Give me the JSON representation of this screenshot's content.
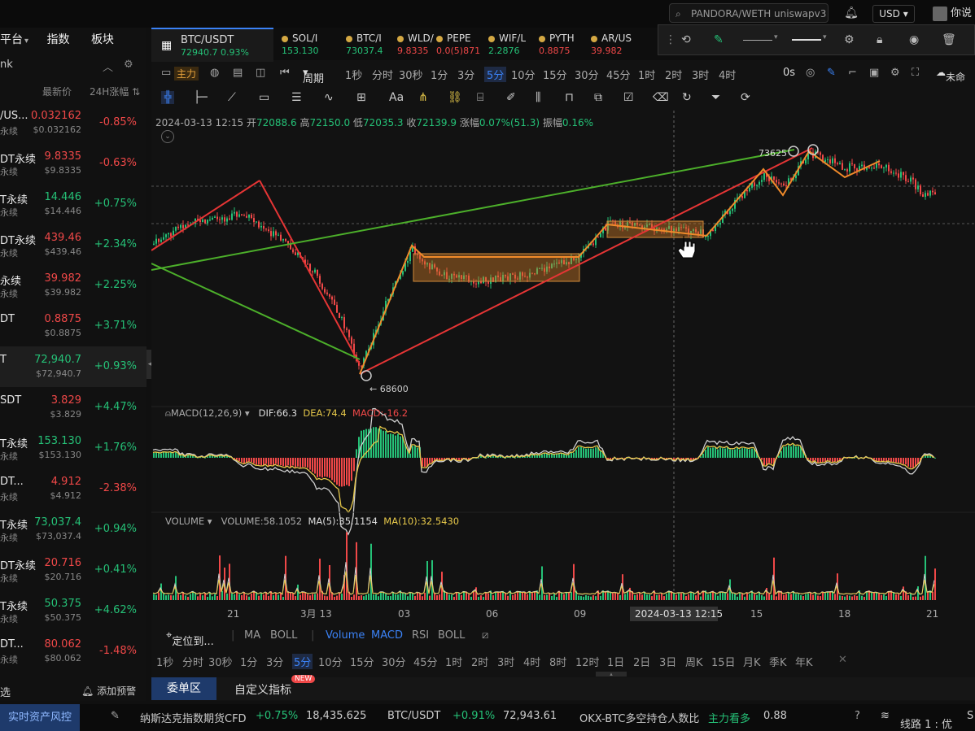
{
  "topbar": {
    "search_placeholder": "PANDORA/WETH uniswapv3",
    "currency": "USD",
    "user_label": "你说"
  },
  "left_panel": {
    "tabs": [
      "平台",
      "指数",
      "板块"
    ],
    "filter_label": "nk",
    "col_price": "最新价",
    "col_change": "24H涨幅",
    "rows": [
      {
        "name": "/US...",
        "sub": "永续",
        "price": "0.032162",
        "price2": "$0.032162",
        "change": "-0.85%",
        "dir": "dn"
      },
      {
        "name": "DT永续",
        "sub": "永续",
        "price": "9.8335",
        "price2": "$9.8335",
        "change": "-0.63%",
        "dir": "dn"
      },
      {
        "name": "T永续",
        "sub": "永续",
        "price": "14.446",
        "price2": "$14.446",
        "change": "+0.75%",
        "dir": "up"
      },
      {
        "name": "DT永续",
        "sub": "永续",
        "price": "439.46",
        "price2": "$439.46",
        "change": "+2.34%",
        "dir": "dn"
      },
      {
        "name": "永续",
        "sub": "永续",
        "price": "39.982",
        "price2": "$39.982",
        "change": "+2.25%",
        "dir": "dn"
      },
      {
        "name": "DT",
        "sub": "",
        "price": "0.8875",
        "price2": "$0.8875",
        "change": "+3.71%",
        "dir": "dn"
      },
      {
        "name": "T",
        "sub": "",
        "price": "72,940.7",
        "price2": "$72,940.7",
        "change": "+0.93%",
        "dir": "up"
      },
      {
        "name": "SDT",
        "sub": "",
        "price": "3.829",
        "price2": "$3.829",
        "change": "+4.47%",
        "dir": "dn"
      },
      {
        "name": "T永续",
        "sub": "永续",
        "price": "153.130",
        "price2": "$153.130",
        "change": "+1.76%",
        "dir": "up"
      },
      {
        "name": "DT...",
        "sub": "永续",
        "price": "4.912",
        "price2": "$4.912",
        "change": "-2.38%",
        "dir": "dn"
      },
      {
        "name": "T永续",
        "sub": "永续",
        "price": "73,037.4",
        "price2": "$73,037.4",
        "change": "+0.94%",
        "dir": "up"
      },
      {
        "name": "DT永续",
        "sub": "永续",
        "price": "20.716",
        "price2": "$20.716",
        "change": "+0.41%",
        "dir": "dn"
      },
      {
        "name": "T永续",
        "sub": "永续",
        "price": "50.375",
        "price2": "$50.375",
        "change": "+4.62%",
        "dir": "up"
      },
      {
        "name": "DT...",
        "sub": "永续",
        "price": "80.062",
        "price2": "$80.062",
        "change": "-1.48%",
        "dir": "dn"
      }
    ],
    "bottom_left": "选",
    "alert": "添加预警"
  },
  "symbol_tabs": [
    {
      "name": "BTC/USDT",
      "price": "72940.7",
      "change": "0.93%"
    },
    {
      "name": "SOL/I",
      "price": "153.130"
    },
    {
      "name": "BTC/I",
      "price": "73037.4"
    },
    {
      "name": "WLD/",
      "price": "9.8335"
    },
    {
      "name": "PEPE",
      "price": "0.0(5)871"
    },
    {
      "name": "WIF/L",
      "price": "2.2876"
    },
    {
      "name": "PYTH",
      "price": "0.8875"
    },
    {
      "name": "AR/US",
      "price": "39.982"
    }
  ],
  "period_bar": {
    "main_label": "主力",
    "period_label": "周期",
    "periods": [
      "1秒",
      "分时",
      "30秒",
      "1分",
      "3分",
      "5分",
      "10分",
      "15分",
      "30分",
      "45分",
      "1时",
      "2时",
      "3时",
      "4时"
    ],
    "active": "5分",
    "right_label": "0s",
    "far_right": "未命"
  },
  "ohlc": {
    "date": "2024-03-13 12:15",
    "open_label": "开",
    "open": "72088.6",
    "high_label": "高",
    "high": "72150.0",
    "low_label": "低",
    "low": "72035.3",
    "close_label": "收",
    "close": "72139.9",
    "chg_label": "涨幅",
    "chg": "0.07%(51.3)",
    "amp_label": "振幅",
    "amp": "0.16%"
  },
  "chart": {
    "high_label": "73625",
    "low_label": "← 68600",
    "x_ticks": [
      "21",
      "3月 13",
      "03",
      "06",
      "09",
      "15",
      "18",
      "21"
    ],
    "crosshair_label": "2024-03-13 12:15"
  },
  "macd": {
    "label": "MACD(12,26,9)",
    "dif": "DIF:66.3",
    "dea": "DEA:74.4",
    "macd": "MACD:-16.2"
  },
  "volume": {
    "label": "VOLUME",
    "vol": "VOLUME:58.1052",
    "ma5": "MA(5):35.1154",
    "ma10": "MA(10):32.5430"
  },
  "bottom_indicators": {
    "locate": "定位到...",
    "items": [
      "MA",
      "BOLL",
      "Volume",
      "MACD",
      "RSI",
      "BOLL"
    ]
  },
  "bottom_periods": {
    "items": [
      "1秒",
      "分时",
      "30秒",
      "1分",
      "3分",
      "5分",
      "10分",
      "15分",
      "30分",
      "45分",
      "1时",
      "2时",
      "3时",
      "4时",
      "8时",
      "12时",
      "1日",
      "2日",
      "3日",
      "周K",
      "15日",
      "月K",
      "季K",
      "年K"
    ],
    "active": "5分"
  },
  "order_tabs": {
    "tab1": "委单区",
    "tab2": "自定义指标",
    "new": "NEW"
  },
  "ticker": {
    "risk": "实时资产风控",
    "item1_name": "纳斯达克指数期货CFD",
    "item1_chg": "+0.75%",
    "item1_val": "18,435.625",
    "item2_name": "BTC/USDT",
    "item2_chg": "+0.91%",
    "item2_val": "72,943.61",
    "item3_name": "OKX-BTC多空持仓人数比",
    "item3_tag": "主力看多",
    "item3_val": "0.88",
    "line": "线路 1 : 优",
    "line_end": "S"
  },
  "colors": {
    "up": "#25c177",
    "down": "#f04848",
    "accent": "#3b82f6",
    "macd_dea": "#e6c84a"
  }
}
